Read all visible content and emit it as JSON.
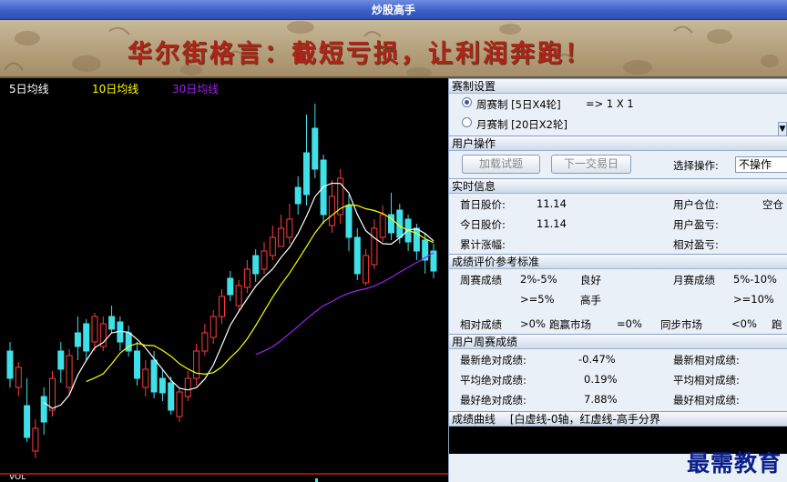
{
  "window": {
    "title": "炒股高手"
  },
  "banner": {
    "slogan": "华尔街格言：截短亏损，让利润奔跑！"
  },
  "chart": {
    "ma_legend": [
      {
        "label": "5日均线",
        "color": "#ffffff"
      },
      {
        "label": "10日均线",
        "color": "#ffff00"
      },
      {
        "label": "30日均线",
        "color": "#a020f0"
      }
    ],
    "volume_label": "VOL"
  },
  "match_settings": {
    "header": "赛制设置",
    "weekly": {
      "label": "周赛制 [5日X4轮]",
      "detail": "=>  1 X 1",
      "selected": true
    },
    "monthly": {
      "label": "月赛制 [20日X2轮]",
      "selected": false
    }
  },
  "user_ops": {
    "header": "用户操作",
    "load_btn": "加载试题",
    "next_day_btn": "下一交易日",
    "choose_label": "选择操作:",
    "choose_value": "不操作"
  },
  "realtime": {
    "header": "实时信息",
    "first_price_label": "首日股价:",
    "first_price_value": "11.14",
    "today_price_label": "今日股价:",
    "today_price_value": "11.14",
    "cumulative_label": "累计涨幅:",
    "position_label": "用户仓位:",
    "position_value": "空仓",
    "profit_label": "用户盈亏:",
    "relative_profit_label": "相对盈亏:"
  },
  "evaluation": {
    "header": "成绩评价参考标准",
    "weekly_label": "周赛成绩",
    "weekly_good_range": "2%-5%",
    "weekly_good": "良好",
    "weekly_expert_range": ">=5%",
    "weekly_expert": "高手",
    "monthly_label": "月赛成绩",
    "monthly_good_range": "5%-10%",
    "monthly_expert_range": ">=10%",
    "relative_label": "相对成绩",
    "relative_gt": ">0%",
    "beat_market": "跑赢市场",
    "relative_eq": "=0%",
    "sync_market": "同步市场",
    "relative_lt": "<0%",
    "lag_market": "跑"
  },
  "weekly_results": {
    "header": "用户周赛成绩",
    "latest_abs_label": "最新绝对成绩:",
    "latest_abs_value": "-0.47%",
    "latest_rel_label": "最新相对成绩:",
    "avg_abs_label": "平均绝对成绩:",
    "avg_abs_value": "0.19%",
    "avg_rel_label": "平均相对成绩:",
    "best_abs_label": "最好绝对成绩:",
    "best_abs_value": "7.88%",
    "best_rel_label": "最好相对成绩:"
  },
  "curve": {
    "header": "成绩曲线",
    "legend": "[白虚线-0轴，红虚线-高手分界"
  },
  "watermark": "最需教育"
}
